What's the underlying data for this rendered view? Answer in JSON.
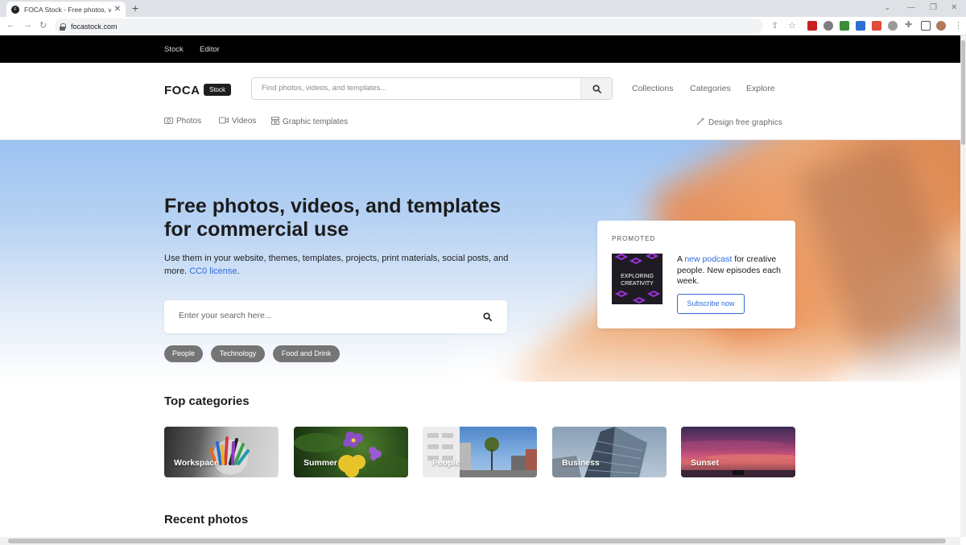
{
  "browser": {
    "tab_title": "FOCA Stock - Free photos, video",
    "url": "focastock.com"
  },
  "topbar": {
    "links": [
      "Stock",
      "Editor"
    ]
  },
  "header": {
    "logo": "FOCA",
    "badge": "Stock",
    "search_placeholder": "Find photos, videos, and templates...",
    "links": [
      "Collections",
      "Categories",
      "Explore"
    ],
    "subnav": [
      "Photos",
      "Videos",
      "Graphic templates"
    ],
    "design_link": "Design free graphics"
  },
  "hero": {
    "title": "Free photos, videos, and templates for commercial use",
    "lead": "Use them in your website, themes, templates, projects, print materials, social posts, and more.",
    "license_link": "CC0 license",
    "search_placeholder": "Enter your search here...",
    "chips": [
      "People",
      "Technology",
      "Food and Drink"
    ]
  },
  "promo": {
    "label": "PROMOTED",
    "tile_text": "EXPLORING CREATIVITY",
    "text_prefix": "A ",
    "link": "new podcast",
    "text_suffix": " for creative people. New episodes each week.",
    "button": "Subscribe now"
  },
  "categories": {
    "title": "Top categories",
    "items": [
      "Workspace",
      "Summer",
      "People",
      "Business",
      "Sunset"
    ]
  },
  "recent": {
    "title": "Recent photos"
  },
  "colors": {
    "accent": "#2f6bd8",
    "topbar": "#000000",
    "chip": "#757575"
  }
}
